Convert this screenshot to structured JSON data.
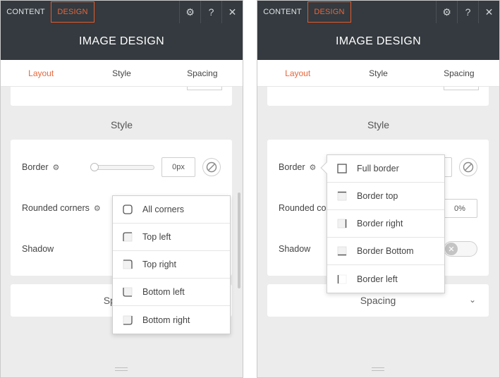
{
  "panels": [
    {
      "tabs": {
        "content": "CONTENT",
        "design": "DESIGN"
      },
      "toolbar_icons": [
        "gear-icon",
        "help-icon",
        "close-icon"
      ],
      "header_title": "IMAGE DESIGN",
      "subtabs": [
        "Layout",
        "Style",
        "Spacing"
      ],
      "active_subtab": "Layout",
      "section_title": "Style",
      "border_label": "Border",
      "border_value": "0px",
      "rounded_label": "Rounded corners",
      "shadow_label": "Shadow",
      "spacing_label": "Spacing",
      "dropdown": [
        "All corners",
        "Top left",
        "Top right",
        "Bottom left",
        "Bottom right"
      ]
    },
    {
      "tabs": {
        "content": "CONTENT",
        "design": "DESIGN"
      },
      "toolbar_icons": [
        "gear-icon",
        "help-icon",
        "close-icon"
      ],
      "header_title": "IMAGE DESIGN",
      "subtabs": [
        "Layout",
        "Style",
        "Spacing"
      ],
      "active_subtab": "Layout",
      "section_title": "Style",
      "border_label": "Border",
      "rounded_label": "Rounded co",
      "rounded_value": "0%",
      "shadow_label": "Shadow",
      "spacing_label": "Spacing",
      "dropdown": [
        "Full border",
        "Border top",
        "Border right",
        "Border Bottom",
        "Border left"
      ]
    }
  ],
  "colors": {
    "accent": "#e8663a",
    "dark_bar": "#343a3f",
    "panel_bg": "#ececec"
  }
}
